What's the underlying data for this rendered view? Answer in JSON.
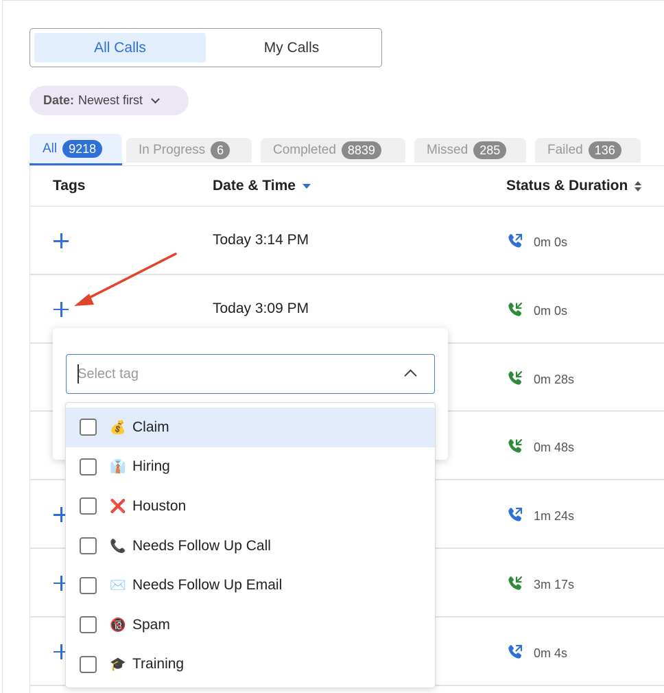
{
  "segmented": {
    "options": [
      {
        "label": "All Calls",
        "active": true
      },
      {
        "label": "My Calls",
        "active": false
      }
    ]
  },
  "filter": {
    "key": "Date:",
    "value": "Newest first"
  },
  "tabs": [
    {
      "label": "All",
      "count": "9218",
      "active": true
    },
    {
      "label": "In Progress",
      "count": "6",
      "active": false
    },
    {
      "label": "Completed",
      "count": "8839",
      "active": false
    },
    {
      "label": "Missed",
      "count": "285",
      "active": false
    },
    {
      "label": "Failed",
      "count": "136",
      "active": false
    }
  ],
  "table": {
    "headers": {
      "tags": "Tags",
      "datetime": "Date & Time",
      "status": "Status & Duration"
    },
    "rows": [
      {
        "datetime": "Today 3:14 PM",
        "duration": "0m 0s",
        "call_icon": "outgoing-call-icon",
        "color": "#2f6fd8"
      },
      {
        "datetime": "Today 3:09 PM",
        "duration": "0m 0s",
        "call_icon": "incoming-call-icon",
        "color": "#2e8b3a"
      },
      {
        "datetime": "",
        "duration": "0m 28s",
        "call_icon": "incoming-call-icon",
        "color": "#2e8b3a"
      },
      {
        "datetime": "",
        "duration": "0m 48s",
        "call_icon": "incoming-call-icon",
        "color": "#2e8b3a"
      },
      {
        "datetime": "",
        "duration": "1m 24s",
        "call_icon": "outgoing-call-icon",
        "color": "#2f6fd8"
      },
      {
        "datetime": "",
        "duration": "3m 17s",
        "call_icon": "incoming-call-icon",
        "color": "#2e8b3a"
      },
      {
        "datetime": "",
        "duration": "0m 4s",
        "call_icon": "outgoing-call-icon",
        "color": "#2f6fd8"
      }
    ]
  },
  "tag_select": {
    "placeholder": "Select tag",
    "options": [
      {
        "emoji": "💰",
        "label": "Claim",
        "highlighted": true
      },
      {
        "emoji": "👔",
        "label": "Hiring",
        "highlighted": false
      },
      {
        "emoji": "❌",
        "label": "Houston",
        "highlighted": false
      },
      {
        "emoji": "📞",
        "label": "Needs Follow Up Call",
        "highlighted": false
      },
      {
        "emoji": "✉️",
        "label": "Needs Follow Up Email",
        "highlighted": false
      },
      {
        "emoji": "🔞",
        "label": "Spam",
        "highlighted": false
      },
      {
        "emoji": "🎓",
        "label": "Training",
        "highlighted": false
      }
    ]
  },
  "colors": {
    "accent": "#2f6fd8",
    "incoming": "#2e8b3a",
    "annotation_arrow": "#e0452c"
  }
}
